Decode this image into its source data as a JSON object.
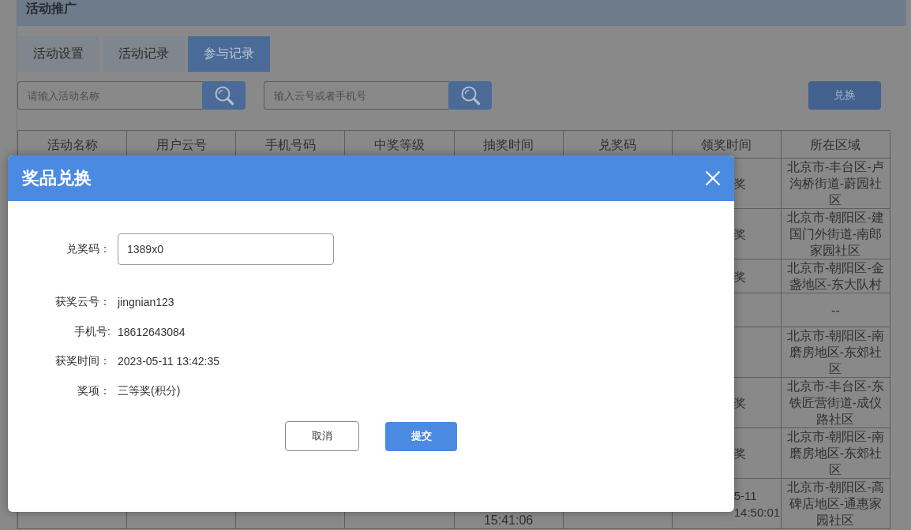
{
  "header": {
    "title": "活动推广"
  },
  "tabs": [
    {
      "label": "活动设置",
      "selected": false
    },
    {
      "label": "活动记录",
      "selected": false
    },
    {
      "label": "参与记录",
      "selected": true
    }
  ],
  "searches": [
    {
      "placeholder": "请输入活动名称"
    },
    {
      "placeholder": "输入云号或者手机号"
    }
  ],
  "exchange_button": {
    "label": "兑换"
  },
  "table": {
    "columns": [
      "活动名称",
      "用户云号",
      "手机号码",
      "中奖等级",
      "抽奖时间",
      "兑奖码",
      "领奖时间",
      "所在区域"
    ],
    "rows": [
      {
        "claim_time": "奖",
        "area": "北京市-丰台区-卢沟桥街道-蔚园社区"
      },
      {
        "claim_time": "奖",
        "area": "北京市-朝阳区-建国门外街道-南郎家园社区"
      },
      {
        "claim_time": "奖",
        "area": "北京市-朝阳区-金盏地区-东大队村"
      },
      {
        "area": "--"
      },
      {
        "area": "北京市-朝阳区-南磨房地区-东郊社区"
      },
      {
        "claim_time": "奖",
        "area": "北京市-丰台区-东铁匠营街道-成仪路社区"
      },
      {
        "claim_time": "奖",
        "area": "北京市-朝阳区-南磨房地区-东郊社区"
      },
      {
        "draw_time": "15:41:06",
        "claim_time": "5-11\n14:50:01",
        "area": "北京市-朝阳区-高碑店地区-通惠家园社区"
      }
    ]
  },
  "dialog": {
    "title": "奖品兑换",
    "fields": [
      {
        "kind": "input",
        "label": "兑奖码：",
        "value": "1389x0"
      },
      {
        "kind": "text",
        "label": "获奖云号：",
        "value": "jingnian123"
      },
      {
        "kind": "text",
        "label": "手机号:",
        "value": "18612643084"
      },
      {
        "kind": "text",
        "label": "获奖时间：",
        "value": "2023-05-11 13:42:35"
      },
      {
        "kind": "text",
        "label": "奖项：",
        "value": "三等奖(积分)"
      }
    ],
    "buttons": [
      {
        "kind": "secondary",
        "label": "取消"
      },
      {
        "kind": "primary",
        "label": "提交"
      }
    ]
  }
}
